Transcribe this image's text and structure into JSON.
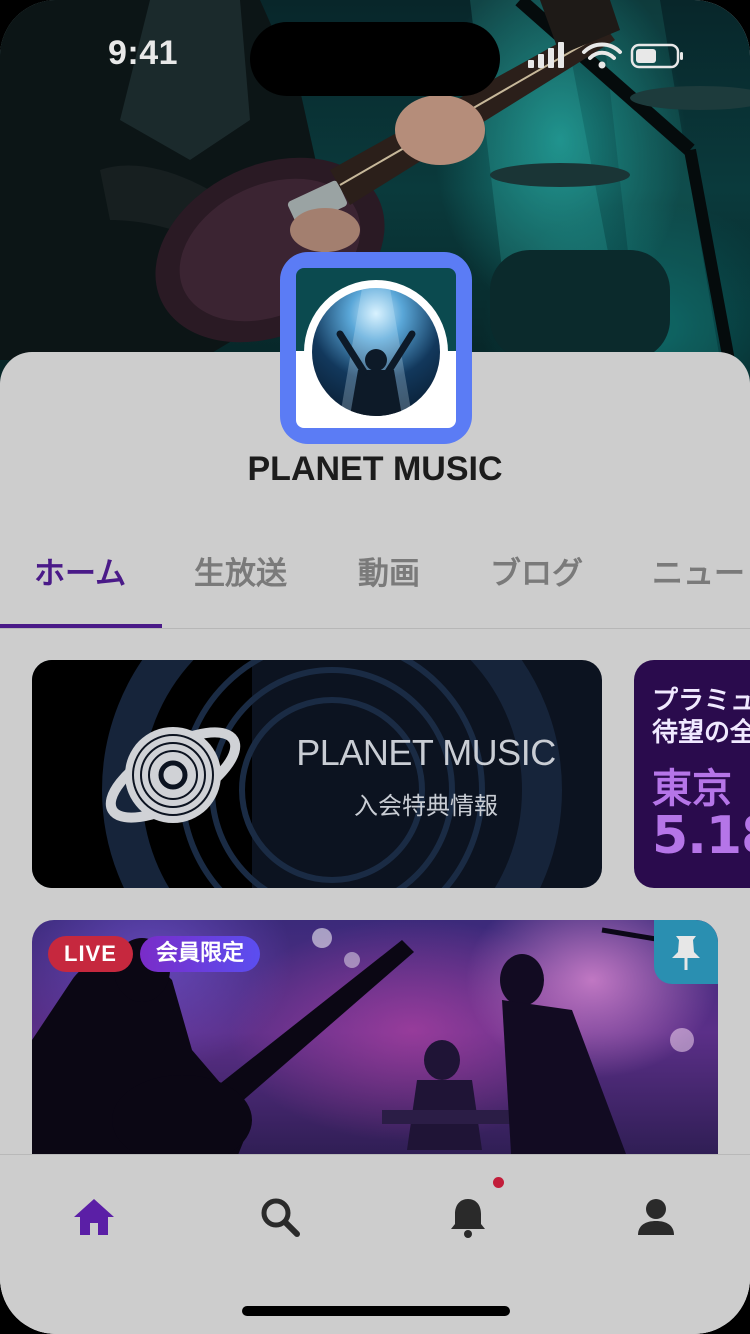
{
  "status_bar": {
    "time": "9:41"
  },
  "profile": {
    "name": "PLANET MUSIC"
  },
  "tabs": [
    {
      "label": "ホーム",
      "active": true
    },
    {
      "label": "生放送",
      "active": false
    },
    {
      "label": "動画",
      "active": false
    },
    {
      "label": "ブログ",
      "active": false
    },
    {
      "label": "ニュー",
      "active": false
    }
  ],
  "banner": {
    "title": "PLANET MUSIC",
    "subtitle": "入会特典情報"
  },
  "promo": {
    "line1": "プラミュ",
    "line2": "待望の全",
    "line3": "東京",
    "line4": "5.18"
  },
  "live_card": {
    "badge_live": "LIVE",
    "badge_member": "会員限定"
  },
  "bottom_nav": {
    "items": [
      {
        "icon": "home-icon",
        "active": true
      },
      {
        "icon": "search-icon",
        "active": false
      },
      {
        "icon": "bell-icon",
        "active": false,
        "has_notification": true
      },
      {
        "icon": "user-icon",
        "active": false
      }
    ]
  },
  "colors": {
    "accent": "#4a1a88",
    "avatar_frame": "#5b7cf5",
    "live": "#c6283e",
    "notification": "#c21d3a",
    "pin": "#2a8fb1"
  }
}
